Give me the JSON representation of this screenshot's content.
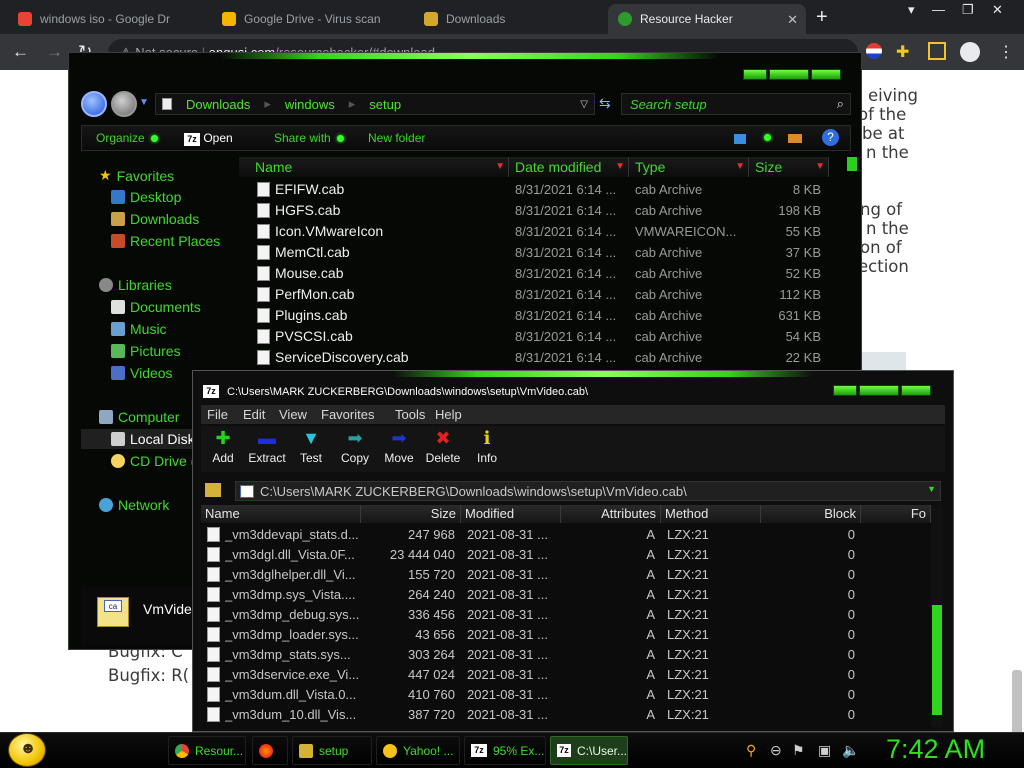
{
  "browser": {
    "tabs": [
      {
        "title": "windows iso - Google Dr",
        "icon": "google-icon"
      },
      {
        "title": "Google Drive - Virus scan",
        "icon": "drive-icon"
      },
      {
        "title": "Downloads",
        "icon": "folder-icon"
      },
      {
        "title": "Resource Hacker",
        "icon": "resource-hacker-icon"
      }
    ],
    "security": "Not secure",
    "url_host": "angusj.com",
    "url_path": "/resourcehacker/#download"
  },
  "webpage": {
    "fragments": [
      "eiving",
      "of the",
      "be at",
      "n the",
      "ng of",
      "n the",
      "on of",
      "ection",
      "Bugfix:  C",
      "Bugfix:  R("
    ]
  },
  "explorer": {
    "breadcrumb": [
      "Downloads",
      "windows",
      "setup"
    ],
    "search_placeholder": "Search setup",
    "toolbar": {
      "organize": "Organize",
      "open": "Open",
      "share": "Share with",
      "new_folder": "New folder"
    },
    "sidebar": {
      "favorites": "Favorites",
      "desktop": "Desktop",
      "downloads": "Downloads",
      "recent": "Recent Places",
      "libraries": "Libraries",
      "documents": "Documents",
      "music": "Music",
      "pictures": "Pictures",
      "videos": "Videos",
      "computer": "Computer",
      "local_disk": "Local Disk",
      "cd_drive": "CD Drive (E",
      "network": "Network"
    },
    "preview_name": "VmVide",
    "columns": {
      "name": "Name",
      "date": "Date modified",
      "type": "Type",
      "size": "Size"
    },
    "files": [
      {
        "name": "EFIFW.cab",
        "date": "8/31/2021 6:14 ...",
        "type": "cab Archive",
        "size": "8 KB"
      },
      {
        "name": "HGFS.cab",
        "date": "8/31/2021 6:14 ...",
        "type": "cab Archive",
        "size": "198 KB"
      },
      {
        "name": "Icon.VMwareIcon",
        "date": "8/31/2021 6:14 ...",
        "type": "VMWAREICON...",
        "size": "55 KB"
      },
      {
        "name": "MemCtl.cab",
        "date": "8/31/2021 6:14 ...",
        "type": "cab Archive",
        "size": "37 KB"
      },
      {
        "name": "Mouse.cab",
        "date": "8/31/2021 6:14 ...",
        "type": "cab Archive",
        "size": "52 KB"
      },
      {
        "name": "PerfMon.cab",
        "date": "8/31/2021 6:14 ...",
        "type": "cab Archive",
        "size": "112 KB"
      },
      {
        "name": "Plugins.cab",
        "date": "8/31/2021 6:14 ...",
        "type": "cab Archive",
        "size": "631 KB"
      },
      {
        "name": "PVSCSI.cab",
        "date": "8/31/2021 6:14 ...",
        "type": "cab Archive",
        "size": "54 KB"
      },
      {
        "name": "ServiceDiscovery.cab",
        "date": "8/31/2021 6:14 ...",
        "type": "cab Archive",
        "size": "22 KB"
      }
    ]
  },
  "zip": {
    "title": "C:\\Users\\MARK ZUCKERBERG\\Downloads\\windows\\setup\\VmVideo.cab\\",
    "menu": [
      "File",
      "Edit",
      "View",
      "Favorites",
      "Tools",
      "Help"
    ],
    "toolbar": [
      {
        "label": "Add",
        "icon": "plus-icon",
        "color": "#22d41c"
      },
      {
        "label": "Extract",
        "icon": "minus-icon",
        "color": "#1c2fe0"
      },
      {
        "label": "Test",
        "icon": "test-arrow-icon",
        "color": "#25c8d8"
      },
      {
        "label": "Copy",
        "icon": "copy-arrow-icon",
        "color": "#2d9e9e"
      },
      {
        "label": "Move",
        "icon": "move-arrow-icon",
        "color": "#2233cc"
      },
      {
        "label": "Delete",
        "icon": "delete-x-icon",
        "color": "#e02222"
      },
      {
        "label": "Info",
        "icon": "info-icon",
        "color": "#e8d21a"
      }
    ],
    "path": "C:\\Users\\MARK ZUCKERBERG\\Downloads\\windows\\setup\\VmVideo.cab\\",
    "columns": {
      "name": "Name",
      "size": "Size",
      "modified": "Modified",
      "attributes": "Attributes",
      "method": "Method",
      "block": "Block",
      "folders": "Fo"
    },
    "files": [
      {
        "name": "_vm3ddevapi_stats.d...",
        "size": "247 968",
        "modified": "2021-08-31 ...",
        "attr": "A",
        "method": "LZX:21",
        "block": "0"
      },
      {
        "name": "_vm3dgl.dll_Vista.0F...",
        "size": "23 444 040",
        "modified": "2021-08-31 ...",
        "attr": "A",
        "method": "LZX:21",
        "block": "0"
      },
      {
        "name": "_vm3dglhelper.dll_Vi...",
        "size": "155 720",
        "modified": "2021-08-31 ...",
        "attr": "A",
        "method": "LZX:21",
        "block": "0"
      },
      {
        "name": "_vm3dmp.sys_Vista....",
        "size": "264 240",
        "modified": "2021-08-31 ...",
        "attr": "A",
        "method": "LZX:21",
        "block": "0"
      },
      {
        "name": "_vm3dmp_debug.sys...",
        "size": "336 456",
        "modified": "2021-08-31 ...",
        "attr": "A",
        "method": "LZX:21",
        "block": "0"
      },
      {
        "name": "_vm3dmp_loader.sys...",
        "size": "43 656",
        "modified": "2021-08-31 ...",
        "attr": "A",
        "method": "LZX:21",
        "block": "0"
      },
      {
        "name": "_vm3dmp_stats.sys...",
        "size": "303 264",
        "modified": "2021-08-31 ...",
        "attr": "A",
        "method": "LZX:21",
        "block": "0"
      },
      {
        "name": "_vm3dservice.exe_Vi...",
        "size": "447 024",
        "modified": "2021-08-31 ...",
        "attr": "A",
        "method": "LZX:21",
        "block": "0"
      },
      {
        "name": "_vm3dum.dll_Vista.0...",
        "size": "410 760",
        "modified": "2021-08-31 ...",
        "attr": "A",
        "method": "LZX:21",
        "block": "0"
      },
      {
        "name": "_vm3dum_10.dll_Vis...",
        "size": "387 720",
        "modified": "2021-08-31 ...",
        "attr": "A",
        "method": "LZX:21",
        "block": "0"
      }
    ]
  },
  "taskbar": {
    "items": [
      {
        "label": "Resour...",
        "icon": "chrome-icon"
      },
      {
        "label": "",
        "icon": "firefox-icon"
      },
      {
        "label": "setup",
        "icon": "folder-icon"
      },
      {
        "label": "Yahoo! ...",
        "icon": "yahoo-icon"
      },
      {
        "label": "95% Ex...",
        "icon": "7zip-icon"
      },
      {
        "label": "C:\\User...",
        "icon": "7zip-icon"
      }
    ],
    "clock": "7:42 AM"
  },
  "colors": {
    "accent_green": "#3ed42b",
    "taskbar_active": "#1e3d1a",
    "chrome_dark": "#202124"
  }
}
